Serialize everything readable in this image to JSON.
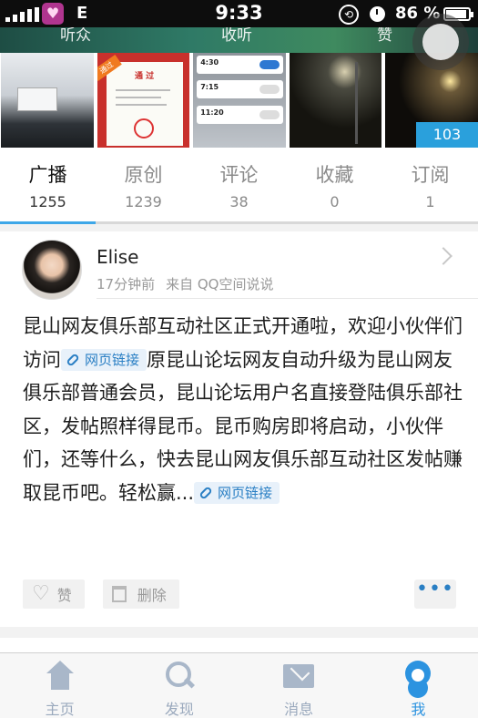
{
  "status_bar": {
    "network": "E",
    "time": "9:33",
    "battery": "86 %"
  },
  "cover": {
    "labels": [
      "听众",
      "收听",
      "赞"
    ]
  },
  "photos": {
    "p2_title": "通 过",
    "p2_badge": "通过",
    "p3_rows": [
      "4:30",
      "7:15",
      "11:20"
    ],
    "count": "103"
  },
  "tabs": [
    {
      "label": "广播",
      "count": "1255"
    },
    {
      "label": "原创",
      "count": "1239"
    },
    {
      "label": "评论",
      "count": "38"
    },
    {
      "label": "收藏",
      "count": "0"
    },
    {
      "label": "订阅",
      "count": "1"
    }
  ],
  "post": {
    "author": "Elise",
    "time": "17分钟前",
    "source": "来自 QQ空间说说",
    "text_1": "昆山网友俱乐部互动社区正式开通啦，欢迎小伙伴们访问",
    "link_label": "网页链接",
    "text_2": "原昆山论坛网友自动升级为昆山网友俱乐部普通会员，昆山论坛用户名直接登陆俱乐部社区，发帖照样得昆币。昆币购房即将启动，小伙伴们，还等什么，快去昆山网友俱乐部互动社区发帖赚取昆币吧。轻松赢...",
    "like_label": "赞",
    "delete_label": "删除",
    "more_label": "•••"
  },
  "nav": [
    {
      "label": "主页",
      "icon": "home-icon"
    },
    {
      "label": "发现",
      "icon": "discover-icon"
    },
    {
      "label": "消息",
      "icon": "message-icon"
    },
    {
      "label": "我",
      "icon": "profile-icon"
    }
  ],
  "colors": {
    "accent": "#2c93e0",
    "tab_indicator": "#3ea7e8",
    "link": "#2a7fc4"
  }
}
